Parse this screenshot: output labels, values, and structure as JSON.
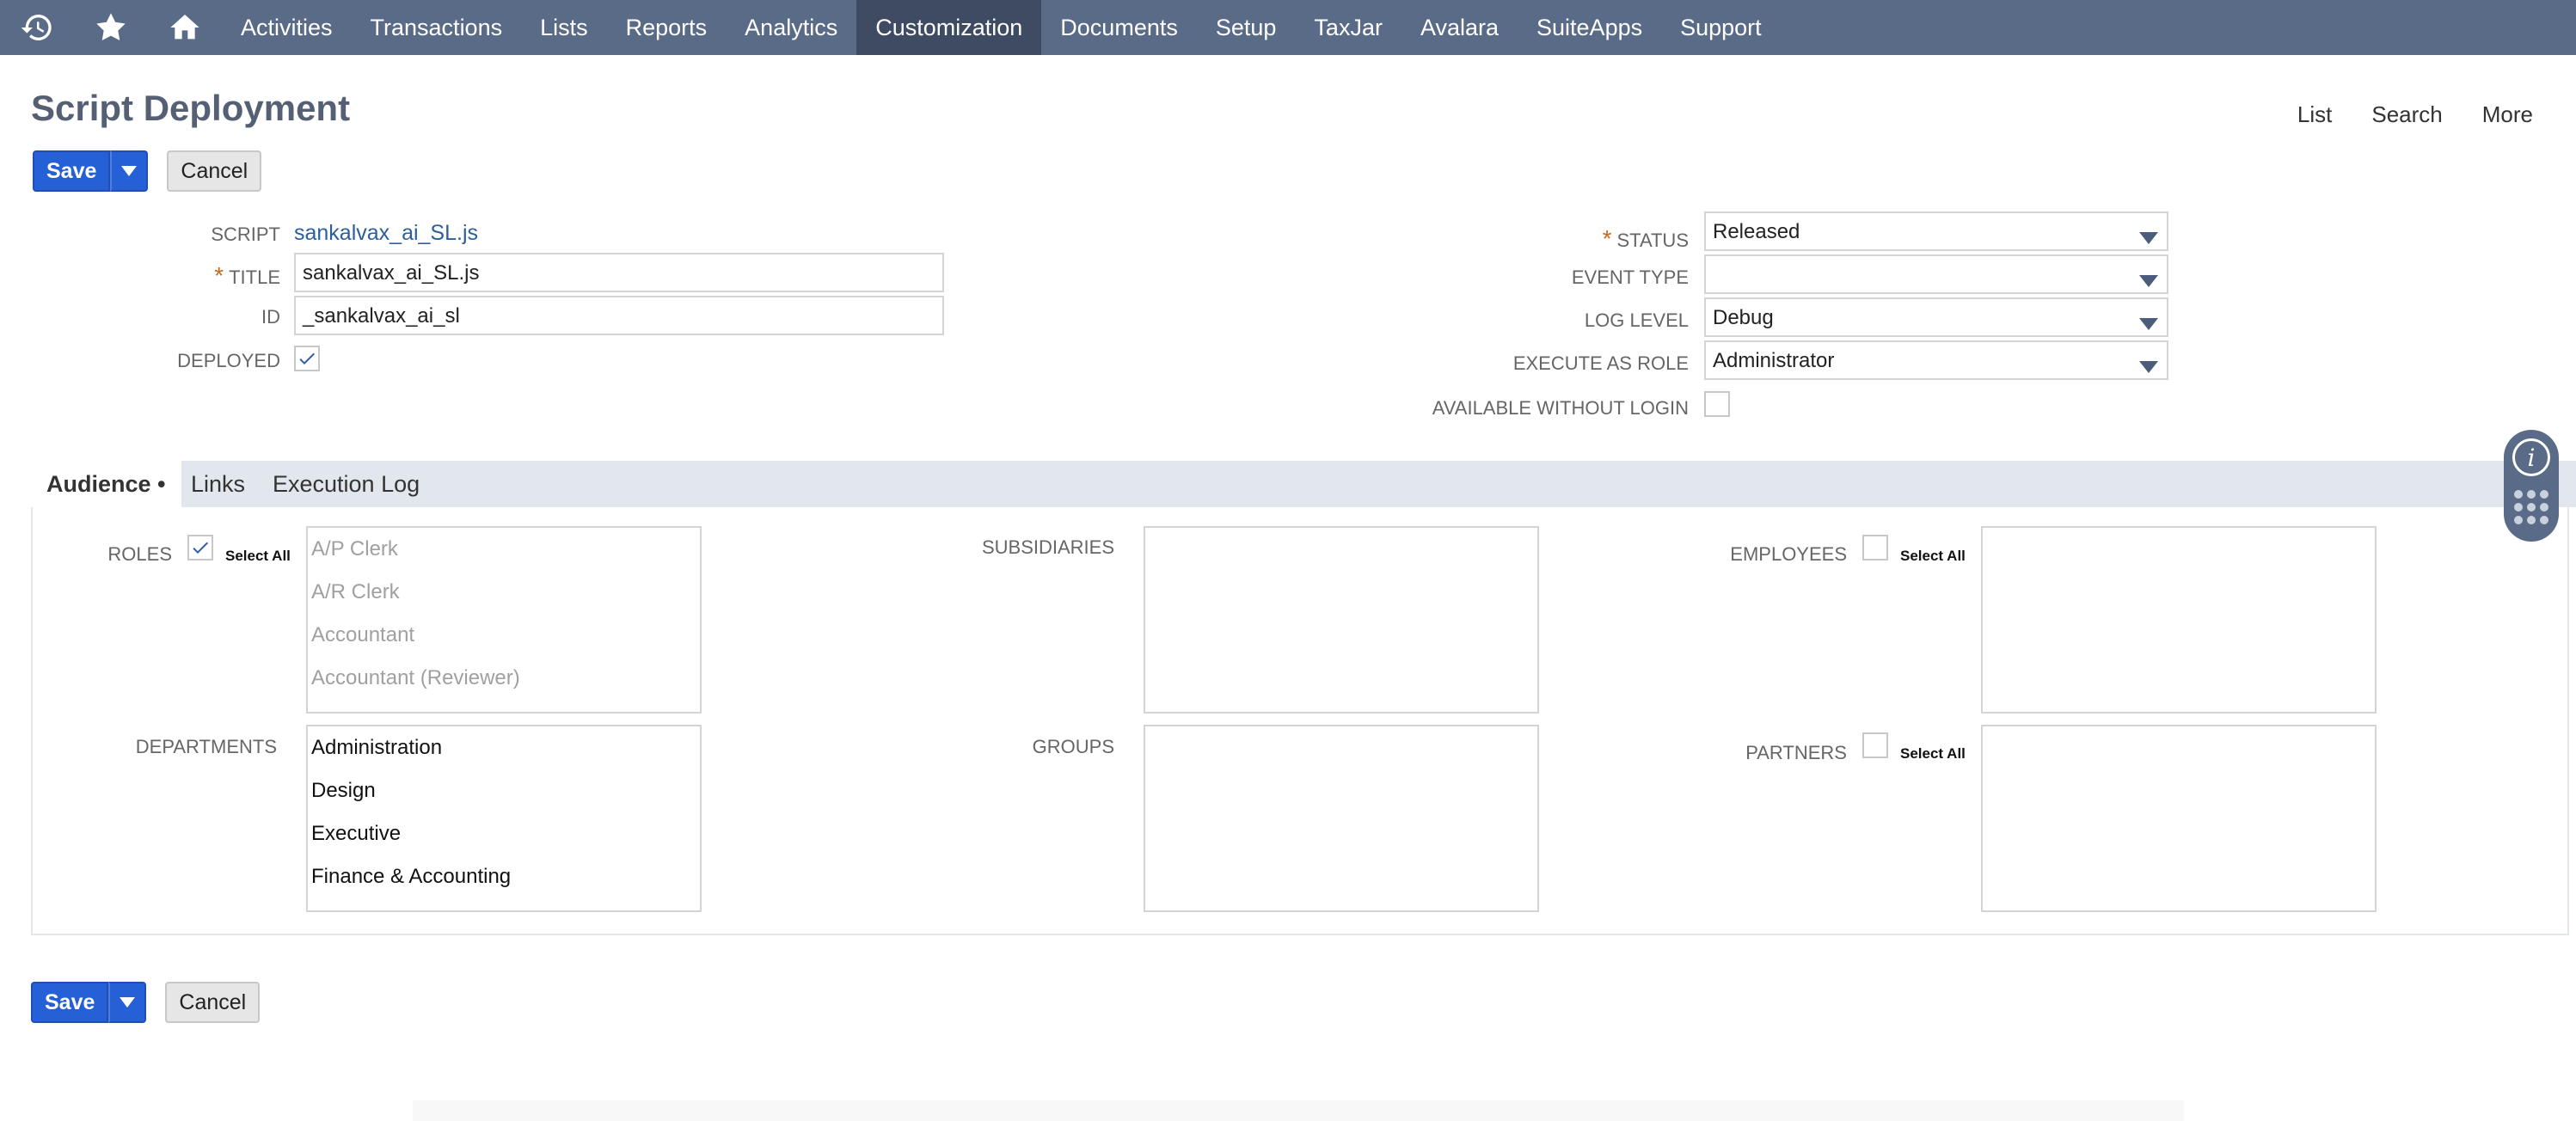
{
  "nav": {
    "icons": [
      "recent-icon",
      "star-icon",
      "home-icon"
    ],
    "items": [
      "Activities",
      "Transactions",
      "Lists",
      "Reports",
      "Analytics",
      "Customization",
      "Documents",
      "Setup",
      "TaxJar",
      "Avalara",
      "SuiteApps",
      "Support"
    ],
    "active": "Customization"
  },
  "header": {
    "title": "Script Deployment",
    "links": [
      "List",
      "Search",
      "More"
    ]
  },
  "buttons": {
    "save": "Save",
    "cancel": "Cancel"
  },
  "form": {
    "script_label": "SCRIPT",
    "script_value": "sankalvax_ai_SL.js",
    "title_label": "TITLE",
    "title_value": "sankalvax_ai_SL.js",
    "id_label": "ID",
    "id_value": "_sankalvax_ai_sl",
    "deployed_label": "DEPLOYED",
    "deployed_checked": true,
    "status_label": "STATUS",
    "status_value": "Released",
    "event_type_label": "EVENT TYPE",
    "event_type_value": "",
    "log_level_label": "LOG LEVEL",
    "log_level_value": "Debug",
    "execute_as_role_label": "EXECUTE AS ROLE",
    "execute_as_role_value": "Administrator",
    "available_without_login_label": "AVAILABLE WITHOUT LOGIN",
    "available_without_login_checked": false
  },
  "subtabs": {
    "audience": "Audience",
    "audience_marker": "•",
    "links": "Links",
    "execution_log": "Execution Log"
  },
  "audience": {
    "roles_label": "ROLES",
    "roles_select_all_checked": true,
    "roles": [
      "A/P Clerk",
      "A/R Clerk",
      "Accountant",
      "Accountant (Reviewer)"
    ],
    "select_all": "Select All",
    "subsidiaries_label": "SUBSIDIARIES",
    "employees_label": "EMPLOYEES",
    "employees_select_all_checked": false,
    "departments_label": "DEPARTMENTS",
    "departments": [
      "Administration",
      "Design",
      "Executive",
      "Finance & Accounting"
    ],
    "groups_label": "GROUPS",
    "partners_label": "PARTNERS",
    "partners_select_all_checked": false
  },
  "colors": {
    "nav_bg": "#5a6b87",
    "nav_active": "#3e4b62",
    "primary_button": "#2660d6",
    "link": "#2d5d9c",
    "required": "#c96a1a"
  }
}
